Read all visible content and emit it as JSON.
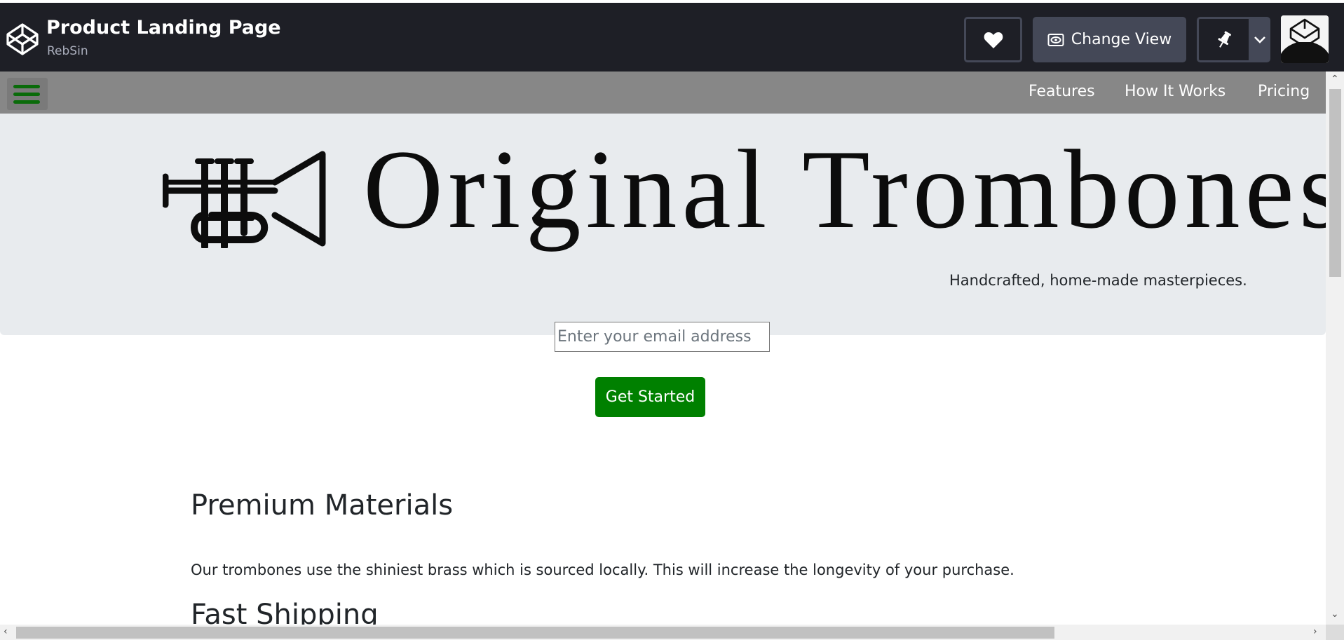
{
  "codepen": {
    "pen_title": "Product Landing Page",
    "author": "RebSin",
    "change_view_label": "Change View"
  },
  "navbar": {
    "links": [
      {
        "label": "Features"
      },
      {
        "label": "How It Works"
      },
      {
        "label": "Pricing"
      }
    ]
  },
  "hero": {
    "brand": "Original Trombones",
    "tagline": "Handcrafted, home-made masterpieces."
  },
  "form": {
    "email_placeholder": "Enter your email address",
    "submit_label": "Get Started"
  },
  "features": [
    {
      "heading": "Premium Materials",
      "text": "Our trombones use the shiniest brass which is sourced locally. This will increase the longevity of your purchase."
    },
    {
      "heading": "Fast Shipping"
    }
  ],
  "colors": {
    "topbar_bg": "#1e1f26",
    "nav_bg": "#878787",
    "hero_bg": "#e8ebee",
    "button_green": "#008000",
    "hamburger_green": "#0a6b0a"
  },
  "icons": {
    "logo": "codepen-logo-icon",
    "heart": "heart-icon",
    "view": "eye-icon",
    "pin": "pin-icon",
    "dropdown": "chevron-down-icon",
    "menu": "hamburger-menu-icon",
    "brand": "trumpet-icon"
  }
}
